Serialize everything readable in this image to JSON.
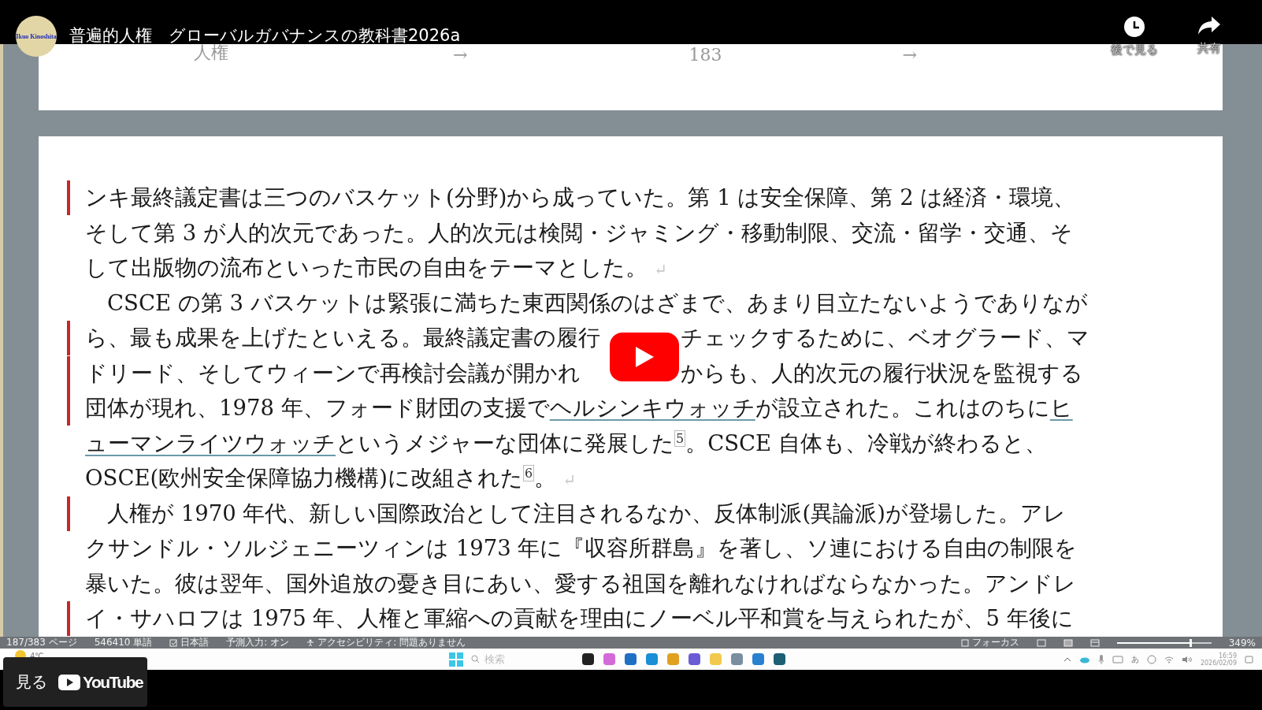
{
  "video": {
    "channel_logo": "Ikuo Kinoshita",
    "title": "普遍的人権　グローバルガバナンスの教科書2026a",
    "actions": [
      {
        "kind": "watch_later",
        "label": "後で見る"
      },
      {
        "kind": "share",
        "label": "共有"
      }
    ]
  },
  "document": {
    "page_header": [
      "人権",
      "→",
      "183",
      "→"
    ],
    "lines": [
      {
        "change_bar": true,
        "segments": [
          {
            "kind": "text",
            "text": "ンキ最終議定書は三つのバスケット(分野)から成っていた。第 1 は安全保障、第 2 は経済・環境、"
          }
        ]
      },
      {
        "change_bar": false,
        "segments": [
          {
            "kind": "text",
            "text": "そして第 3 が人的次元であった。人的次元は検閲・ジャミング・移動制限、交流・留学・交通、そ"
          }
        ]
      },
      {
        "change_bar": false,
        "segments": [
          {
            "kind": "text",
            "text": "して出版物の流布といった市民の自由をテーマとした。"
          },
          {
            "kind": "para_mark",
            "text": "↵"
          }
        ]
      },
      {
        "change_bar": false,
        "segments": [
          {
            "kind": "text",
            "text": "　CSCE の第 3 バスケットは緊張に満ちた東西関係のはざまで、あまり目立たないようでありなが"
          }
        ]
      },
      {
        "change_bar": true,
        "segments": [
          {
            "kind": "text",
            "text": "ら、最も成果を上げたといえる。最終議定書の履行"
          },
          {
            "kind": "resume",
            "text": "チェックするために、ベオグラード、マ"
          }
        ]
      },
      {
        "change_bar": true,
        "segments": [
          {
            "kind": "text",
            "text": "ドリード、そしてウィーンで再検討会議が開かれ"
          },
          {
            "kind": "resume",
            "text": "からも、人的次元の履行状況を監視する"
          }
        ]
      },
      {
        "change_bar": true,
        "segments": [
          {
            "kind": "text",
            "text": "団体が現れ、1978 年、フォード財団の支援で"
          },
          {
            "kind": "link",
            "text": "ヘルシンキウォッチ"
          },
          {
            "kind": "text",
            "text": "が設立された。これはのちに"
          },
          {
            "kind": "link",
            "text": "ヒ"
          }
        ]
      },
      {
        "change_bar": false,
        "segments": [
          {
            "kind": "link",
            "text": "ューマンライツウォッチ"
          },
          {
            "kind": "text",
            "text": "というメジャーな団体に発展した"
          },
          {
            "kind": "footnote",
            "text": "5"
          },
          {
            "kind": "text",
            "text": "。CSCE 自体も、冷戦が終わると、"
          }
        ]
      },
      {
        "change_bar": false,
        "segments": [
          {
            "kind": "text",
            "text": "OSCE(欧州安全保障協力機構)に改組された"
          },
          {
            "kind": "footnote",
            "text": "6"
          },
          {
            "kind": "text",
            "text": "。"
          },
          {
            "kind": "para_mark",
            "text": "↵"
          }
        ]
      },
      {
        "change_bar": true,
        "segments": [
          {
            "kind": "text",
            "text": "　人権が 1970 年代、新しい国際政治として注目されるなか、反体制派(異論派)が登場した。アレ"
          }
        ]
      },
      {
        "change_bar": false,
        "segments": [
          {
            "kind": "text",
            "text": "クサンドル・ソルジェニーツィンは 1973 年に『収容所群島』を著し、ソ連における自由の制限を"
          }
        ]
      },
      {
        "change_bar": false,
        "segments": [
          {
            "kind": "text",
            "text": "暴いた。彼は翌年、国外追放の憂き目にあい、愛する祖国を離れなければならなかった。アンドレ"
          }
        ]
      },
      {
        "change_bar": true,
        "segments": [
          {
            "kind": "text",
            "text": "イ・サハロフは 1975 年、人権と軍縮への貢献を理由にノーベル平和賞を与えられたが、5 年後に"
          }
        ]
      }
    ]
  },
  "status_bar": {
    "left": [
      "187/383 ページ",
      "546410 単語",
      "日本語",
      "予測入力: オン",
      "アクセシビリティ: 問題ありません"
    ],
    "focus": "フォーカス",
    "zoom": {
      "level": 0.78,
      "reading": "349%"
    }
  },
  "taskbar": {
    "weather": "4℃",
    "search_placeholder": "検索",
    "ime": "あ",
    "time": "16:59",
    "date": "2026/02/09"
  },
  "watch_on_youtube": {
    "label": "見る",
    "logo": "YouTube"
  }
}
